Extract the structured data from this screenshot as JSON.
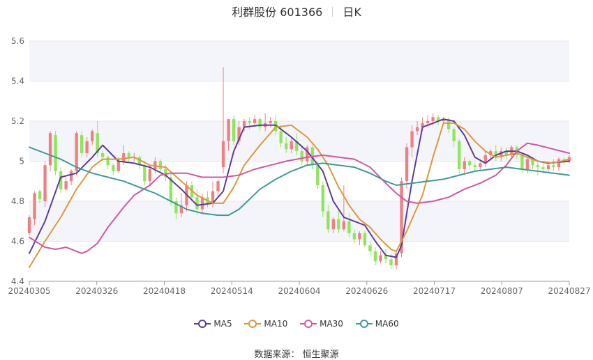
{
  "header": {
    "title": "利群股份 601366",
    "period": "日K"
  },
  "source_label": "数据来源： 恒生聚源",
  "chart_data": {
    "type": "candlestick",
    "ylim": [
      4.4,
      5.6
    ],
    "yticks": [
      "4.4",
      "4.6",
      "4.8",
      "5",
      "5.2",
      "5.4",
      "5.6"
    ],
    "xticks": [
      "20240305",
      "20240326",
      "20240418",
      "20240514",
      "20240604",
      "20240626",
      "20240717",
      "20240807",
      "20240827"
    ],
    "colors": {
      "up": "#f08080",
      "down": "#8ee65a",
      "MA5": "#5a3c9c",
      "MA10": "#e0963c",
      "MA30": "#d257a0",
      "MA60": "#3d9a9a"
    },
    "candles": [
      [
        4.64,
        4.72,
        4.63,
        4.73
      ],
      [
        4.71,
        4.84,
        4.68,
        4.85
      ],
      [
        4.85,
        4.81,
        4.79,
        4.86
      ],
      [
        4.8,
        4.98,
        4.77,
        5.0
      ],
      [
        4.98,
        5.14,
        4.95,
        5.15
      ],
      [
        5.13,
        4.95,
        4.93,
        5.15
      ],
      [
        4.95,
        4.86,
        4.84,
        4.97
      ],
      [
        4.86,
        4.9,
        4.85,
        4.92
      ],
      [
        4.9,
        4.95,
        4.88,
        4.96
      ],
      [
        4.95,
        5.14,
        4.93,
        5.15
      ],
      [
        5.13,
        5.04,
        5.02,
        5.15
      ],
      [
        5.04,
        5.1,
        5.02,
        5.12
      ],
      [
        5.1,
        5.15,
        5.08,
        5.16
      ],
      [
        5.14,
        5.04,
        5.02,
        5.2
      ],
      [
        5.04,
        5.02,
        5.0,
        5.05
      ],
      [
        5.02,
        4.98,
        4.96,
        5.03
      ],
      [
        4.98,
        4.95,
        4.93,
        4.99
      ],
      [
        4.95,
        5.0,
        4.94,
        5.02
      ],
      [
        5.0,
        5.04,
        4.98,
        5.08
      ],
      [
        5.04,
        5.02,
        4.99,
        5.05
      ],
      [
        5.02,
        5.02,
        5.0,
        5.04
      ],
      [
        5.02,
        4.98,
        4.96,
        5.03
      ],
      [
        4.98,
        4.9,
        4.88,
        5.0
      ],
      [
        4.9,
        4.96,
        4.88,
        4.98
      ],
      [
        4.96,
        5.0,
        4.94,
        5.02
      ],
      [
        5.0,
        4.96,
        4.94,
        5.01
      ],
      [
        4.96,
        4.92,
        4.9,
        4.98
      ],
      [
        4.92,
        4.8,
        4.78,
        4.94
      ],
      [
        4.8,
        4.74,
        4.71,
        4.82
      ],
      [
        4.74,
        4.78,
        4.72,
        4.84
      ],
      [
        4.78,
        4.88,
        4.75,
        4.9
      ],
      [
        4.88,
        4.82,
        4.8,
        4.9
      ],
      [
        4.82,
        4.76,
        4.73,
        4.86
      ],
      [
        4.76,
        4.82,
        4.74,
        4.84
      ],
      [
        4.82,
        4.79,
        4.77,
        4.85
      ],
      [
        4.79,
        4.85,
        4.77,
        4.9
      ],
      [
        4.85,
        4.9,
        4.82,
        4.91
      ],
      [
        4.97,
        5.1,
        4.94,
        5.47
      ],
      [
        5.1,
        5.21,
        5.05,
        5.21
      ],
      [
        5.21,
        5.1,
        5.08,
        5.23
      ],
      [
        5.1,
        5.17,
        5.08,
        5.2
      ],
      [
        5.17,
        5.2,
        5.15,
        5.21
      ],
      [
        5.2,
        5.19,
        5.16,
        5.22
      ],
      [
        5.19,
        5.21,
        5.17,
        5.23
      ],
      [
        5.21,
        5.17,
        5.15,
        5.22
      ],
      [
        5.17,
        5.19,
        5.15,
        5.24
      ],
      [
        5.19,
        5.2,
        5.17,
        5.22
      ],
      [
        5.2,
        5.15,
        5.13,
        5.23
      ],
      [
        5.15,
        5.09,
        5.07,
        5.18
      ],
      [
        5.09,
        5.06,
        5.04,
        5.12
      ],
      [
        5.06,
        5.1,
        5.04,
        5.12
      ],
      [
        5.1,
        5.05,
        5.03,
        5.14
      ],
      [
        5.05,
        5.0,
        4.98,
        5.08
      ],
      [
        5.0,
        5.07,
        4.98,
        5.08
      ],
      [
        5.07,
        4.98,
        4.96,
        5.08
      ],
      [
        4.98,
        4.88,
        4.86,
        5.0
      ],
      [
        4.88,
        4.75,
        4.72,
        4.9
      ],
      [
        4.75,
        4.66,
        4.64,
        4.78
      ],
      [
        4.66,
        4.71,
        4.64,
        4.72
      ],
      [
        4.71,
        4.66,
        4.64,
        4.76
      ],
      [
        4.66,
        4.7,
        4.65,
        4.88
      ],
      [
        4.7,
        4.64,
        4.62,
        4.74
      ],
      [
        4.64,
        4.61,
        4.59,
        4.66
      ],
      [
        4.61,
        4.64,
        4.58,
        4.65
      ],
      [
        4.64,
        4.58,
        4.57,
        4.65
      ],
      [
        4.58,
        4.55,
        4.53,
        4.6
      ],
      [
        4.55,
        4.5,
        4.48,
        4.57
      ],
      [
        4.5,
        4.53,
        4.49,
        4.55
      ],
      [
        4.53,
        4.51,
        4.49,
        4.56
      ],
      [
        4.51,
        4.48,
        4.46,
        4.54
      ],
      [
        4.48,
        4.54,
        4.46,
        4.56
      ],
      [
        4.54,
        4.9,
        4.52,
        4.92
      ],
      [
        4.9,
        5.07,
        4.86,
        5.09
      ],
      [
        5.07,
        5.15,
        5.02,
        5.18
      ],
      [
        5.15,
        5.17,
        5.13,
        5.2
      ],
      [
        5.17,
        5.19,
        5.15,
        5.22
      ],
      [
        5.19,
        5.2,
        5.17,
        5.23
      ],
      [
        5.2,
        5.22,
        5.18,
        5.24
      ],
      [
        5.22,
        5.2,
        5.18,
        5.23
      ],
      [
        5.2,
        5.21,
        5.18,
        5.22
      ],
      [
        5.21,
        5.16,
        5.14,
        5.22
      ],
      [
        5.16,
        5.1,
        5.07,
        5.17
      ],
      [
        5.1,
        4.96,
        4.94,
        5.11
      ],
      [
        4.96,
        5.0,
        4.94,
        5.02
      ],
      [
        5.0,
        4.98,
        4.96,
        5.01
      ],
      [
        4.98,
        4.97,
        4.95,
        5.0
      ],
      [
        4.97,
        4.99,
        4.95,
        5.0
      ],
      [
        4.99,
        5.03,
        4.97,
        5.05
      ],
      [
        5.03,
        5.05,
        5.01,
        5.06
      ],
      [
        5.05,
        5.02,
        5.0,
        5.08
      ],
      [
        5.02,
        5.05,
        5.0,
        5.07
      ],
      [
        5.05,
        5.03,
        5.01,
        5.07
      ],
      [
        5.03,
        5.07,
        5.02,
        5.08
      ],
      [
        5.07,
        5.03,
        5.01,
        5.08
      ],
      [
        5.03,
        4.96,
        4.94,
        5.04
      ],
      [
        4.96,
        5.01,
        4.94,
        5.02
      ],
      [
        5.01,
        4.98,
        4.96,
        5.02
      ],
      [
        4.98,
        4.97,
        4.93,
        5.0
      ],
      [
        4.97,
        4.96,
        4.94,
        4.99
      ],
      [
        4.96,
        4.98,
        4.94,
        4.99
      ],
      [
        4.98,
        4.97,
        4.95,
        5.01
      ],
      [
        4.97,
        5.01,
        4.95,
        5.02
      ],
      [
        5.01,
        5.0,
        4.98,
        5.02
      ],
      [
        5.0,
        5.02,
        4.99,
        5.03
      ]
    ],
    "series": [
      {
        "name": "MA5",
        "values": [
          [
            0,
            4.54
          ],
          [
            3,
            4.7
          ],
          [
            6,
            4.92
          ],
          [
            9,
            4.94
          ],
          [
            12,
            5.02
          ],
          [
            14,
            5.08
          ],
          [
            17,
            5.0
          ],
          [
            20,
            4.99
          ],
          [
            23,
            4.97
          ],
          [
            26,
            4.93
          ],
          [
            29,
            4.86
          ],
          [
            32,
            4.78
          ],
          [
            35,
            4.79
          ],
          [
            37,
            4.85
          ],
          [
            39,
            5.05
          ],
          [
            41,
            5.17
          ],
          [
            44,
            5.18
          ],
          [
            47,
            5.18
          ],
          [
            50,
            5.12
          ],
          [
            53,
            5.05
          ],
          [
            56,
            4.95
          ],
          [
            58,
            4.8
          ],
          [
            60,
            4.72
          ],
          [
            62,
            4.7
          ],
          [
            64,
            4.68
          ],
          [
            66,
            4.6
          ],
          [
            68,
            4.53
          ],
          [
            70,
            4.52
          ],
          [
            71,
            4.58
          ],
          [
            73,
            4.9
          ],
          [
            75,
            5.17
          ],
          [
            77,
            5.19
          ],
          [
            79,
            5.21
          ],
          [
            81,
            5.2
          ],
          [
            83,
            5.13
          ],
          [
            85,
            5.02
          ],
          [
            87,
            4.99
          ],
          [
            89,
            5.03
          ],
          [
            91,
            5.05
          ],
          [
            93,
            5.05
          ],
          [
            95,
            5.03
          ],
          [
            97,
            5.0
          ],
          [
            99,
            4.99
          ],
          [
            103,
            5.0
          ]
        ]
      },
      {
        "name": "MA10",
        "values": [
          [
            0,
            4.47
          ],
          [
            3,
            4.6
          ],
          [
            6,
            4.72
          ],
          [
            9,
            4.86
          ],
          [
            12,
            4.97
          ],
          [
            14,
            5.01
          ],
          [
            17,
            5.01
          ],
          [
            20,
            5.02
          ],
          [
            23,
            4.98
          ],
          [
            26,
            4.97
          ],
          [
            29,
            4.9
          ],
          [
            32,
            4.83
          ],
          [
            35,
            4.79
          ],
          [
            37,
            4.79
          ],
          [
            39,
            4.87
          ],
          [
            41,
            4.98
          ],
          [
            44,
            5.08
          ],
          [
            47,
            5.17
          ],
          [
            50,
            5.18
          ],
          [
            53,
            5.12
          ],
          [
            55,
            5.06
          ],
          [
            57,
            4.98
          ],
          [
            59,
            4.87
          ],
          [
            61,
            4.78
          ],
          [
            63,
            4.71
          ],
          [
            65,
            4.67
          ],
          [
            67,
            4.61
          ],
          [
            69,
            4.56
          ],
          [
            70,
            4.55
          ],
          [
            72,
            4.65
          ],
          [
            75,
            4.83
          ],
          [
            77,
            5.02
          ],
          [
            79,
            5.19
          ],
          [
            81,
            5.19
          ],
          [
            83,
            5.16
          ],
          [
            85,
            5.1
          ],
          [
            87,
            5.05
          ],
          [
            89,
            5.02
          ],
          [
            91,
            5.03
          ],
          [
            93,
            5.04
          ],
          [
            95,
            5.02
          ],
          [
            97,
            5.0
          ],
          [
            100,
            4.99
          ],
          [
            103,
            5.01
          ]
        ]
      },
      {
        "name": "MA30",
        "values": [
          [
            0,
            4.62
          ],
          [
            3,
            4.57
          ],
          [
            5,
            4.56
          ],
          [
            7,
            4.57
          ],
          [
            9,
            4.55
          ],
          [
            10,
            4.54
          ],
          [
            11,
            4.55
          ],
          [
            13,
            4.59
          ],
          [
            15,
            4.67
          ],
          [
            18,
            4.77
          ],
          [
            20,
            4.83
          ],
          [
            23,
            4.88
          ],
          [
            25,
            4.93
          ],
          [
            27,
            4.94
          ],
          [
            30,
            4.94
          ],
          [
            33,
            4.92
          ],
          [
            37,
            4.92
          ],
          [
            40,
            4.93
          ],
          [
            43,
            4.96
          ],
          [
            46,
            4.98
          ],
          [
            49,
            5.0
          ],
          [
            53,
            5.02
          ],
          [
            56,
            5.03
          ],
          [
            59,
            5.02
          ],
          [
            62,
            5.01
          ],
          [
            65,
            4.97
          ],
          [
            68,
            4.89
          ],
          [
            70,
            4.84
          ],
          [
            72,
            4.8
          ],
          [
            74,
            4.79
          ],
          [
            77,
            4.8
          ],
          [
            80,
            4.82
          ],
          [
            83,
            4.86
          ],
          [
            86,
            4.89
          ],
          [
            89,
            4.93
          ],
          [
            91,
            4.98
          ],
          [
            93,
            5.05
          ],
          [
            95,
            5.09
          ],
          [
            97,
            5.08
          ],
          [
            100,
            5.06
          ],
          [
            103,
            5.04
          ]
        ]
      },
      {
        "name": "MA60",
        "values": [
          [
            0,
            5.07
          ],
          [
            3,
            5.04
          ],
          [
            6,
            5.01
          ],
          [
            9,
            4.97
          ],
          [
            12,
            4.94
          ],
          [
            15,
            4.92
          ],
          [
            18,
            4.9
          ],
          [
            21,
            4.87
          ],
          [
            24,
            4.84
          ],
          [
            27,
            4.8
          ],
          [
            30,
            4.76
          ],
          [
            33,
            4.74
          ],
          [
            36,
            4.73
          ],
          [
            38,
            4.73
          ],
          [
            40,
            4.76
          ],
          [
            42,
            4.81
          ],
          [
            44,
            4.86
          ],
          [
            47,
            4.91
          ],
          [
            50,
            4.95
          ],
          [
            53,
            4.98
          ],
          [
            56,
            4.99
          ],
          [
            59,
            4.98
          ],
          [
            62,
            4.97
          ],
          [
            65,
            4.94
          ],
          [
            68,
            4.9
          ],
          [
            70,
            4.88
          ],
          [
            73,
            4.89
          ],
          [
            76,
            4.9
          ],
          [
            79,
            4.91
          ],
          [
            82,
            4.93
          ],
          [
            85,
            4.95
          ],
          [
            88,
            4.96
          ],
          [
            91,
            4.97
          ],
          [
            94,
            4.96
          ],
          [
            97,
            4.95
          ],
          [
            100,
            4.94
          ],
          [
            103,
            4.93
          ]
        ]
      }
    ]
  }
}
